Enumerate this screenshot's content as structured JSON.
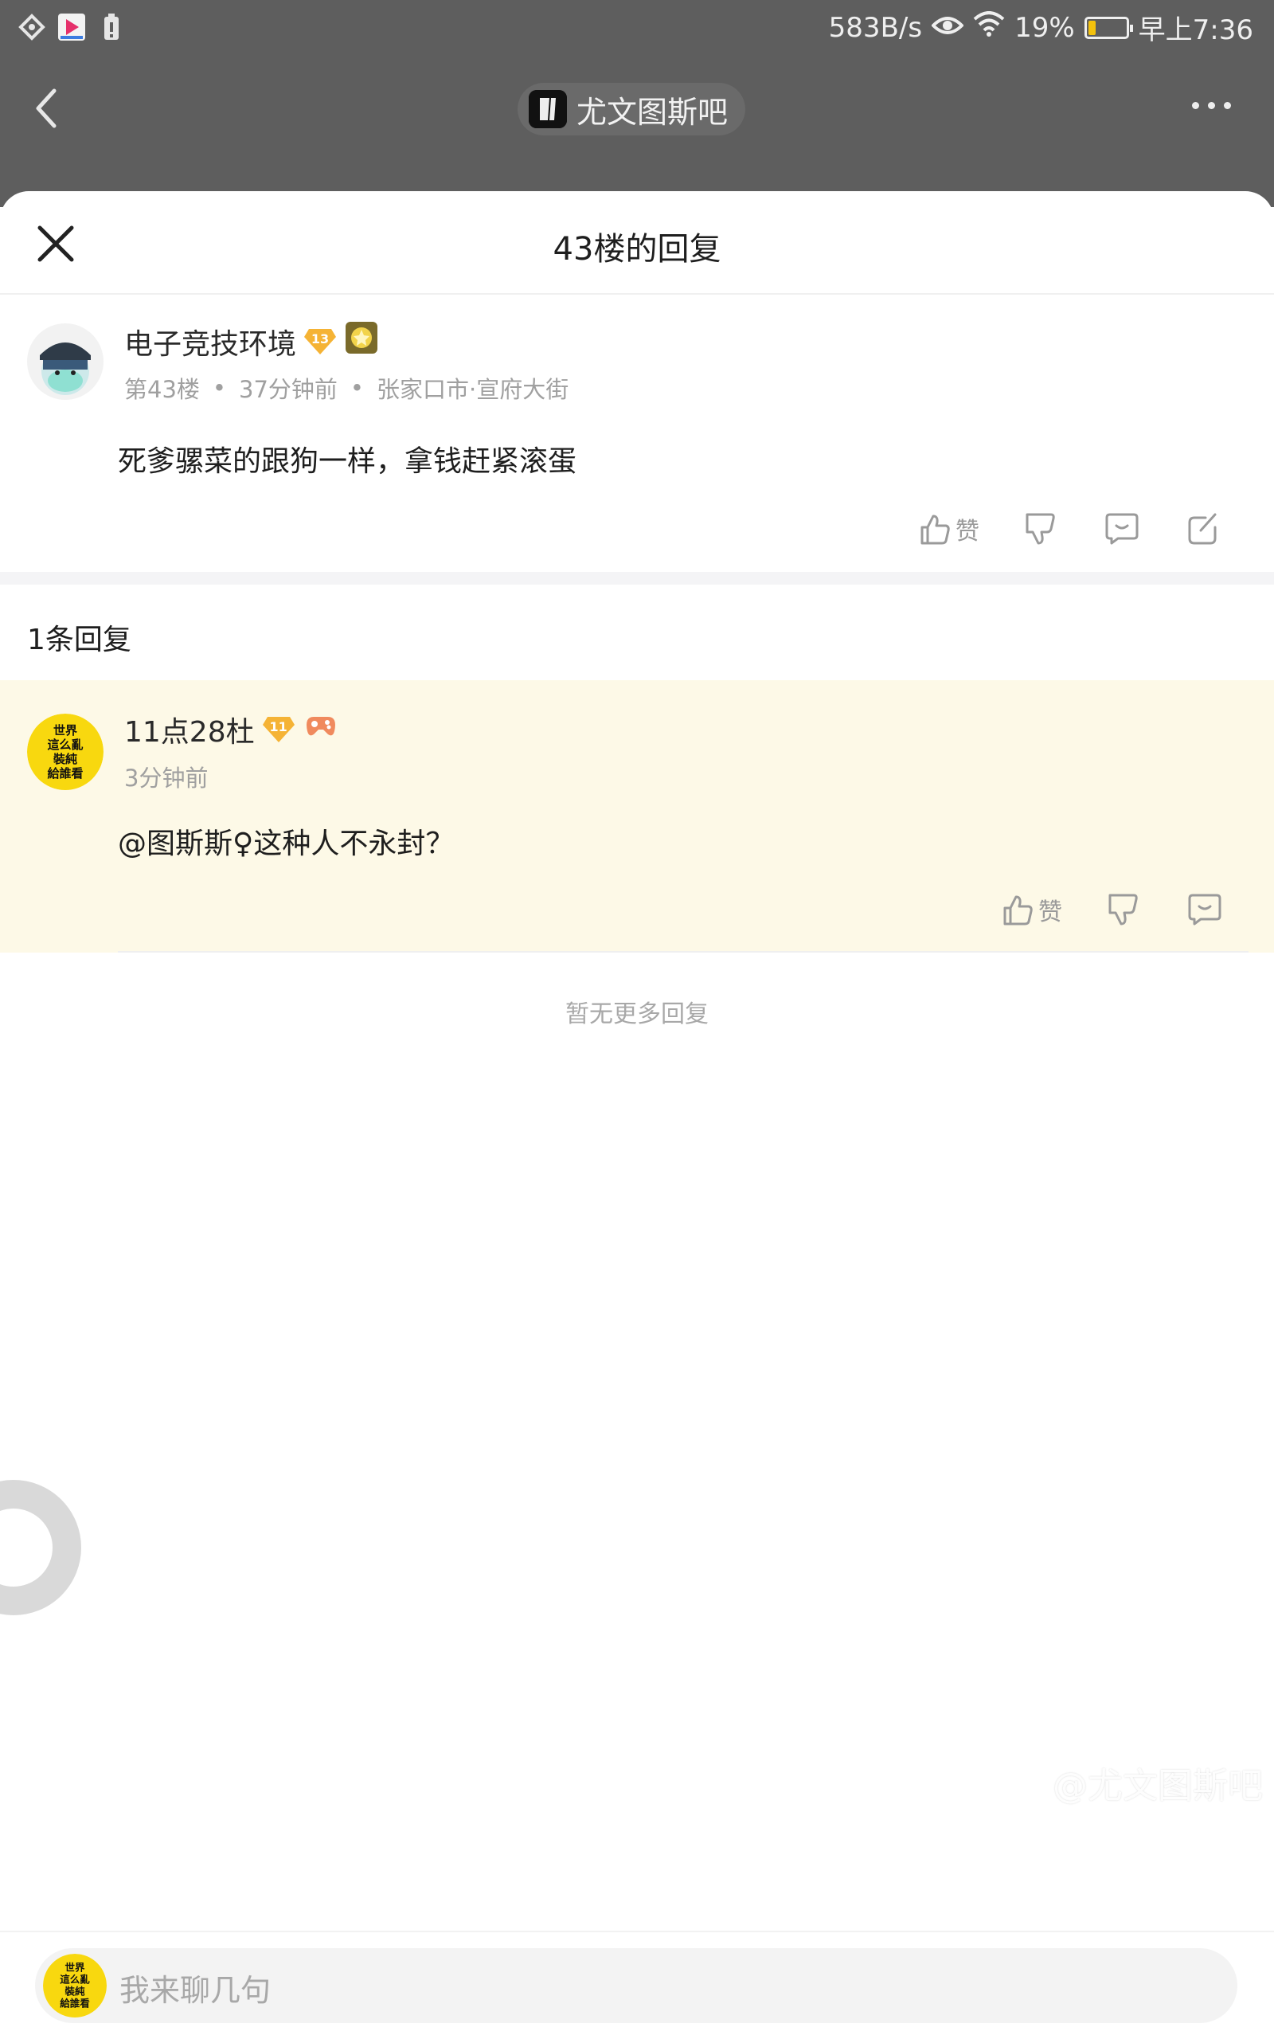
{
  "status_bar": {
    "net_speed": "583B/s",
    "battery_pct": "19%",
    "battery_level": 0.19,
    "time": "早上7:36",
    "icons": [
      "vpn-diamond-icon",
      "video-app-icon",
      "battery-saver-icon",
      "eye-icon",
      "wifi-icon",
      "battery-icon"
    ]
  },
  "nav": {
    "forum_name": "尤文图斯吧"
  },
  "sheet": {
    "title": "43楼的回复"
  },
  "post": {
    "username": "电子竞技环境",
    "level": "13",
    "floor": "第43楼",
    "time": "37分钟前",
    "location": "张家口市·宣府大街",
    "content": "死爹骡菜的跟狗一样，拿钱赶紧滚蛋",
    "like_label": "赞"
  },
  "replies_count_label": "1条回复",
  "reply": {
    "username": "11点28杜",
    "level": "11",
    "time": "3分钟前",
    "content": "@图斯斯♀这种人不永封？",
    "like_label": "赞",
    "avatar_text": [
      "世界",
      "這么亂",
      "裝純",
      "給誰看"
    ]
  },
  "no_more_label": "暂无更多回复",
  "input": {
    "placeholder": "我来聊几句",
    "avatar_text": [
      "世界",
      "這么亂",
      "裝純",
      "給誰看"
    ]
  },
  "watermark": "@尤文图斯吧",
  "colors": {
    "badge_orange": "#f5b335",
    "reply_bg": "#fdf9e7",
    "overlay": "#5e5e5e"
  }
}
